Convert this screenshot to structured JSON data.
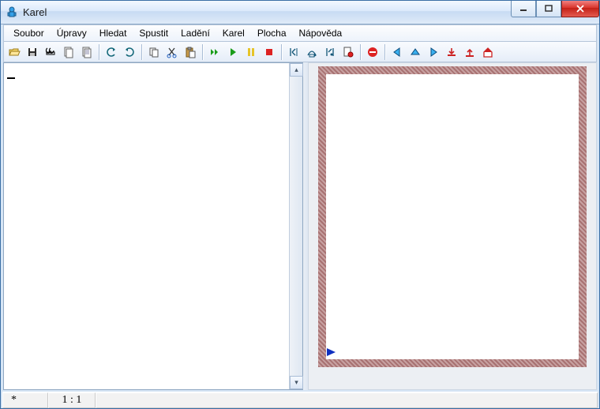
{
  "window": {
    "title": "Karel"
  },
  "menu": {
    "items": [
      "Soubor",
      "Úpravy",
      "Hledat",
      "Spustit",
      "Ladění",
      "Karel",
      "Plocha",
      "Nápověda"
    ]
  },
  "toolbar": {
    "groups": [
      [
        "open",
        "save",
        "find",
        "copy-doc",
        "paste-doc"
      ],
      [
        "undo",
        "redo"
      ],
      [
        "copy",
        "cut",
        "paste"
      ],
      [
        "run-fast",
        "run",
        "pause",
        "stop"
      ],
      [
        "step-left",
        "step-home",
        "step-right",
        "doc-check"
      ],
      [
        "no-entry"
      ],
      [
        "arrow-left",
        "arrow-up",
        "arrow-right",
        "arrow-down-in",
        "arrow-up-out",
        "home"
      ]
    ]
  },
  "editor": {
    "content": ""
  },
  "status": {
    "modified": "*",
    "position": "1 : 1"
  }
}
